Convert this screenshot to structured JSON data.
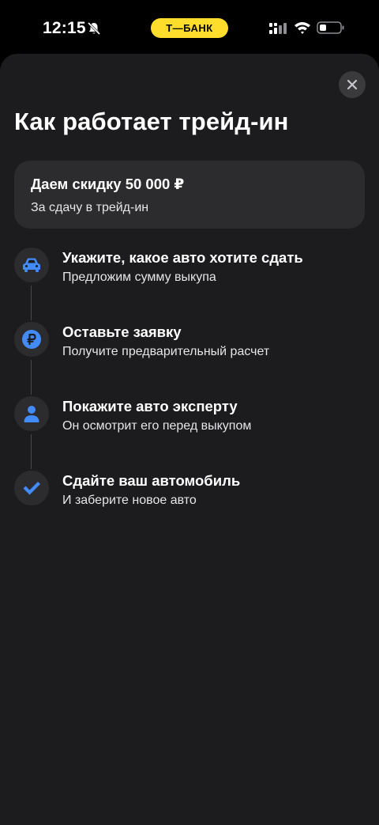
{
  "status_bar": {
    "time": "12:15",
    "bank_pill": "Т—БАНК",
    "pill_color": "#ffdd2d"
  },
  "sheet": {
    "title": "Как работает трейд-ин",
    "close_icon": "close-icon",
    "discount": {
      "title": "Даем скидку 50 000 ₽",
      "subtitle": "За сдачу в трейд-ин"
    },
    "steps": [
      {
        "icon": "car-icon",
        "title": "Укажите, какое авто хотите сдать",
        "subtitle": "Предложим сумму выкупа"
      },
      {
        "icon": "ruble-icon",
        "title": "Оставьте заявку",
        "subtitle": "Получите предварительный расчет"
      },
      {
        "icon": "person-icon",
        "title": "Покажите авто эксперту",
        "subtitle": "Он осмотрит его перед выкупом"
      },
      {
        "icon": "check-icon",
        "title": "Сдайте ваш автомобиль",
        "subtitle": "И заберите новое авто"
      }
    ],
    "accent_color": "#428bf9",
    "background_color": "#1c1c1e",
    "card_color": "#2c2c2e"
  }
}
